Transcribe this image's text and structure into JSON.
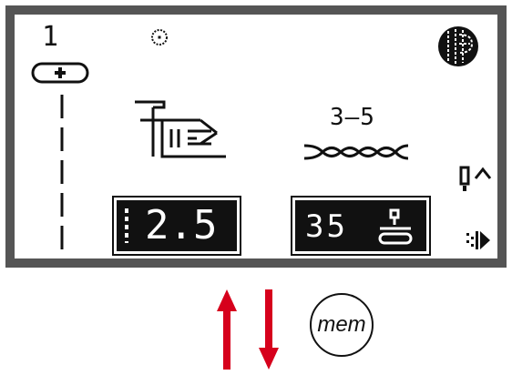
{
  "display": {
    "stitch_number": "1",
    "pattern_range": "3–5",
    "stitch_width": "2.5",
    "stitch_length": "35",
    "icons": {
      "memory": "circle-dot-icon",
      "plus_pill": "plus-pill-icon",
      "globe": "globe-icon",
      "presser_foot": "presser-foot-icon",
      "stitch_pattern": "stitch-pattern-icon",
      "needle_stop": "needle-stop-icon",
      "speed": "speed-icon",
      "reverse": "reverse-icon"
    }
  },
  "controls": {
    "up_arrow": "arrow-up-icon",
    "down_arrow": "arrow-down-icon",
    "mem_label": "mem"
  },
  "colors": {
    "panel": "#555555",
    "lcd_background": "#ffffff",
    "lcd_ink": "#111111",
    "arrow": "#d6001c"
  }
}
